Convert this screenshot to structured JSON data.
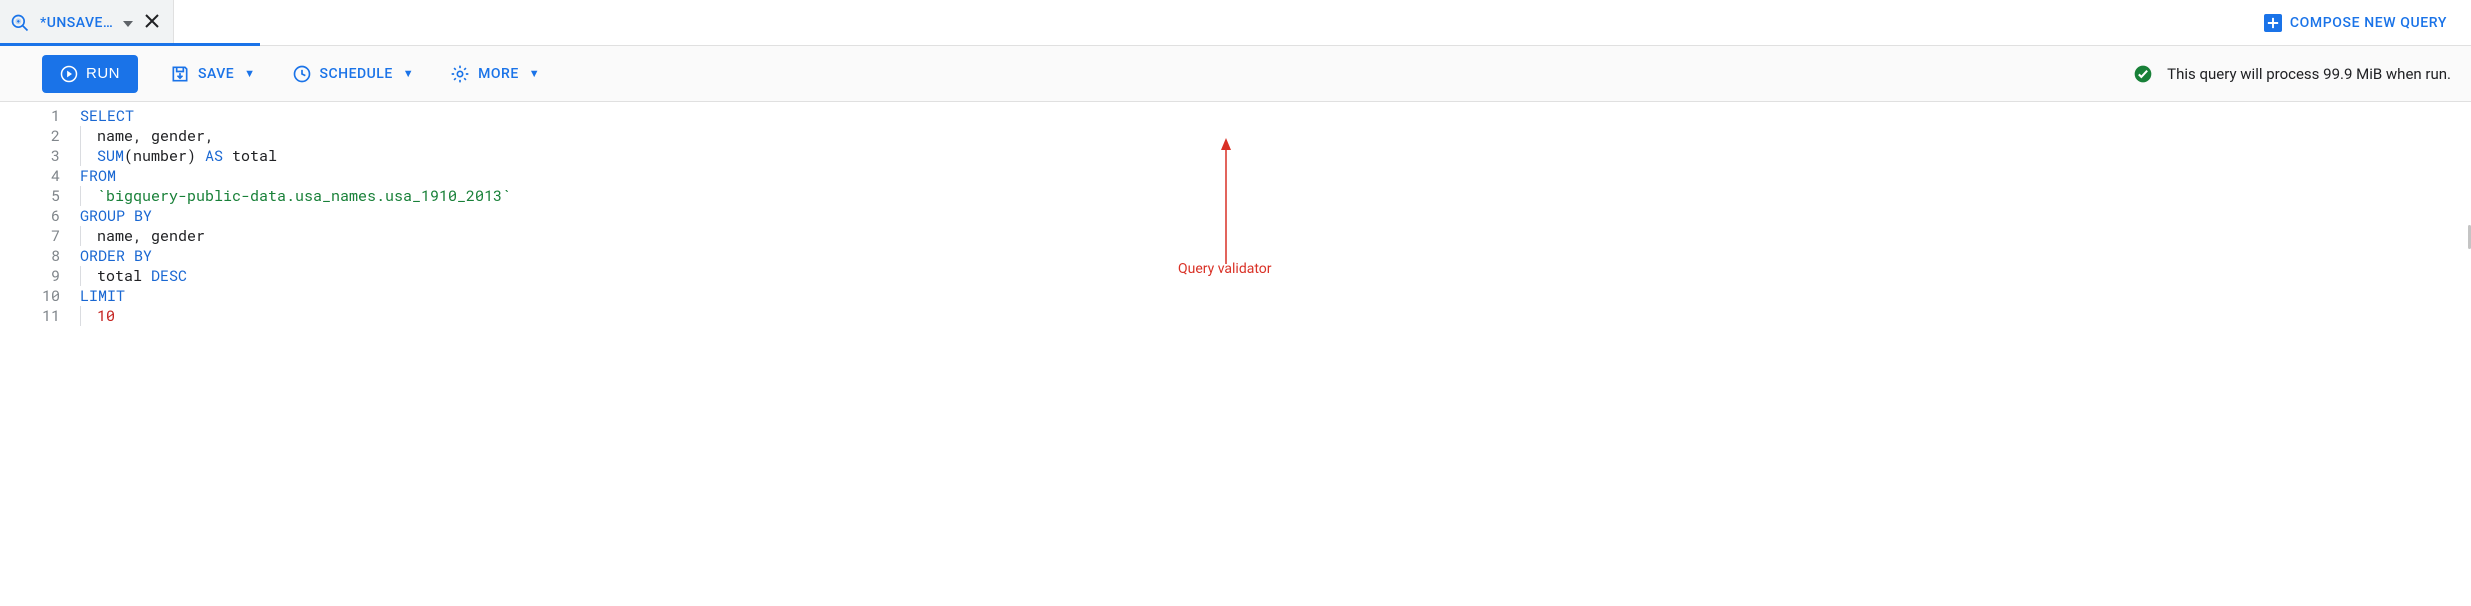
{
  "tab": {
    "title": "*UNSAVE…",
    "icon": "query-magnify"
  },
  "compose": {
    "label": "COMPOSE NEW QUERY"
  },
  "toolbar": {
    "run": "RUN",
    "save": "SAVE",
    "schedule": "SCHEDULE",
    "more": "MORE"
  },
  "status": {
    "text": "This query will process 99.9 MiB when run."
  },
  "annotation": {
    "label": "Query validator"
  },
  "code": {
    "lines": [
      {
        "n": 1,
        "tokens": [
          {
            "t": "SELECT",
            "c": "kw"
          }
        ]
      },
      {
        "n": 2,
        "indent": true,
        "tokens": [
          {
            "t": "name, gender,",
            "c": ""
          }
        ]
      },
      {
        "n": 3,
        "indent": true,
        "tokens": [
          {
            "t": "SUM",
            "c": "kw"
          },
          {
            "t": "(number) ",
            "c": ""
          },
          {
            "t": "AS",
            "c": "kw"
          },
          {
            "t": " total",
            "c": ""
          }
        ]
      },
      {
        "n": 4,
        "tokens": [
          {
            "t": "FROM",
            "c": "kw"
          }
        ]
      },
      {
        "n": 5,
        "indent": true,
        "tokens": [
          {
            "t": "`bigquery-public-data.usa_names.usa_1910_2013`",
            "c": "str"
          }
        ]
      },
      {
        "n": 6,
        "tokens": [
          {
            "t": "GROUP BY",
            "c": "kw"
          }
        ]
      },
      {
        "n": 7,
        "indent": true,
        "tokens": [
          {
            "t": "name, gender",
            "c": ""
          }
        ]
      },
      {
        "n": 8,
        "tokens": [
          {
            "t": "ORDER BY",
            "c": "kw"
          }
        ]
      },
      {
        "n": 9,
        "indent": true,
        "tokens": [
          {
            "t": "total ",
            "c": ""
          },
          {
            "t": "DESC",
            "c": "kw"
          }
        ]
      },
      {
        "n": 10,
        "tokens": [
          {
            "t": "LIMIT",
            "c": "kw"
          }
        ]
      },
      {
        "n": 11,
        "indent": true,
        "tokens": [
          {
            "t": "10",
            "c": "num"
          }
        ]
      }
    ]
  }
}
